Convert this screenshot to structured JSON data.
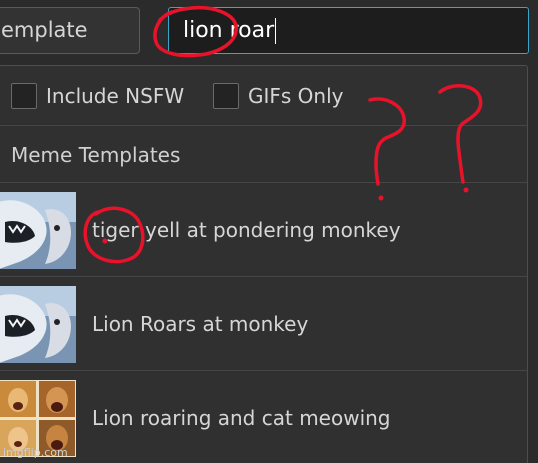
{
  "header": {
    "template_tab_label": "emplate",
    "search": {
      "value": "lion roar"
    }
  },
  "filters": {
    "nsfw_label": "Include NSFW",
    "gifs_label": "GIFs Only"
  },
  "section_title": "Meme Templates",
  "results": [
    {
      "label": "tiger yell at pondering monkey",
      "thumb_icon": "lion-roar-thumbnail"
    },
    {
      "label": "Lion Roars at monkey",
      "thumb_icon": "lion-roar-thumbnail"
    },
    {
      "label": "Lion roaring and cat meowing",
      "thumb_icon": "lion-cat-grid-thumbnail"
    }
  ],
  "watermark": "imgflip.com",
  "colors": {
    "background": "#2b2b2b",
    "input_focus_border": "#37a6c8",
    "annotation_red": "#e8132a"
  }
}
